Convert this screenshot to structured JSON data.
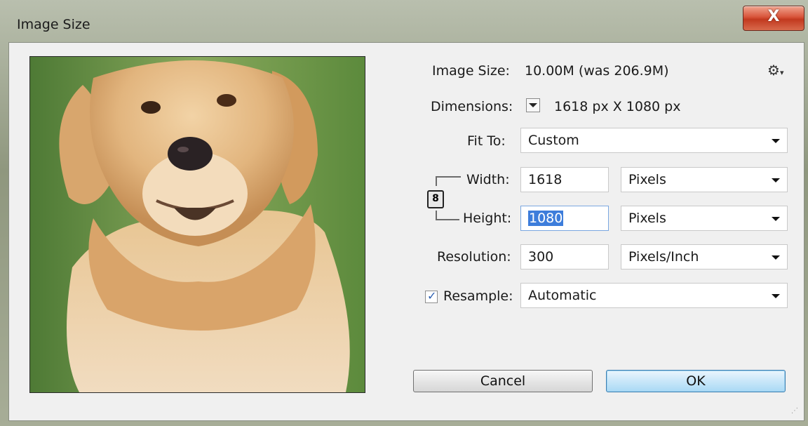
{
  "window": {
    "title": "Image Size",
    "close_label": "X"
  },
  "info": {
    "image_size_label": "Image Size:",
    "image_size_value": "10.00M (was 206.9M)",
    "dimensions_label": "Dimensions:",
    "dimensions_value": "1618 px  X  1080 px"
  },
  "fit_to": {
    "label": "Fit To:",
    "value": "Custom"
  },
  "width": {
    "label": "Width:",
    "value": "1618",
    "unit": "Pixels"
  },
  "height": {
    "label": "Height:",
    "value": "1080",
    "unit": "Pixels"
  },
  "resolution": {
    "label": "Resolution:",
    "value": "300",
    "unit": "Pixels/Inch"
  },
  "resample": {
    "label": "Resample:",
    "checked": true,
    "value": "Automatic"
  },
  "buttons": {
    "cancel": "Cancel",
    "ok": "OK"
  },
  "icons": {
    "settings": "gear-icon",
    "dimensions_dropdown": "dropdown-icon",
    "constrain": "chain-link-icon",
    "close": "close-icon",
    "preview": "dog-photo"
  }
}
